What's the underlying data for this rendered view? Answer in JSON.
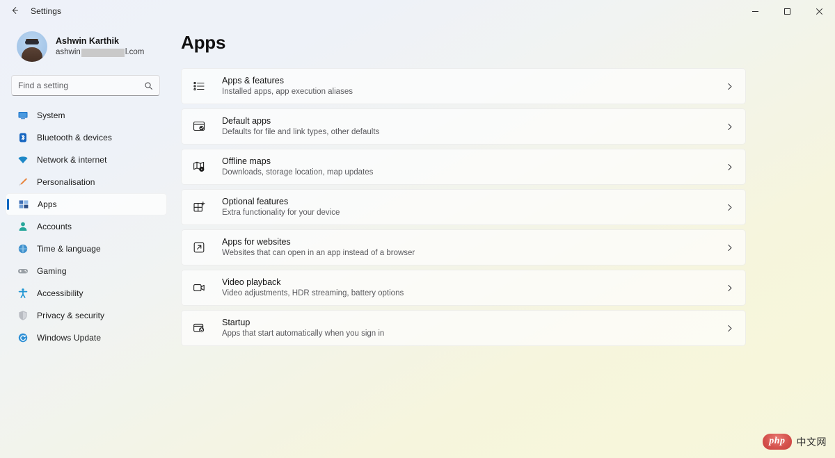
{
  "window": {
    "title": "Settings",
    "back_icon": "back-arrow-icon",
    "controls": {
      "minimize_label": "Minimize",
      "maximize_label": "Maximize",
      "close_label": "Close"
    }
  },
  "account": {
    "name": "Ashwin Karthik",
    "email_prefix": "ashwin",
    "email_suffix": "l.com",
    "avatar_label": "user-avatar"
  },
  "search": {
    "placeholder": "Find a setting",
    "value": "",
    "icon": "search-icon"
  },
  "sidebar": {
    "items": [
      {
        "label": "System",
        "icon": "monitor-icon",
        "selected": false
      },
      {
        "label": "Bluetooth & devices",
        "icon": "bluetooth-icon",
        "selected": false
      },
      {
        "label": "Network & internet",
        "icon": "wifi-icon",
        "selected": false
      },
      {
        "label": "Personalisation",
        "icon": "paintbrush-icon",
        "selected": false
      },
      {
        "label": "Apps",
        "icon": "apps-grid-icon",
        "selected": true
      },
      {
        "label": "Accounts",
        "icon": "person-icon",
        "selected": false
      },
      {
        "label": "Time & language",
        "icon": "clock-globe-icon",
        "selected": false
      },
      {
        "label": "Gaming",
        "icon": "gamepad-icon",
        "selected": false
      },
      {
        "label": "Accessibility",
        "icon": "accessibility-person-icon",
        "selected": false
      },
      {
        "label": "Privacy & security",
        "icon": "shield-icon",
        "selected": false
      },
      {
        "label": "Windows Update",
        "icon": "update-refresh-icon",
        "selected": false
      }
    ]
  },
  "main": {
    "title": "Apps",
    "cards": [
      {
        "title": "Apps & features",
        "subtitle": "Installed apps, app execution aliases",
        "icon": "list-bullets-icon",
        "chevron": "chevron-right-icon"
      },
      {
        "title": "Default apps",
        "subtitle": "Defaults for file and link types, other defaults",
        "icon": "window-check-icon",
        "chevron": "chevron-right-icon"
      },
      {
        "title": "Offline maps",
        "subtitle": "Downloads, storage location, map updates",
        "icon": "map-gear-icon",
        "chevron": "chevron-right-icon"
      },
      {
        "title": "Optional features",
        "subtitle": "Extra functionality for your device",
        "icon": "grid-plus-icon",
        "chevron": "chevron-right-icon"
      },
      {
        "title": "Apps for websites",
        "subtitle": "Websites that can open in an app instead of a browser",
        "icon": "external-link-box-icon",
        "chevron": "chevron-right-icon"
      },
      {
        "title": "Video playback",
        "subtitle": "Video adjustments, HDR streaming, battery options",
        "icon": "video-camera-icon",
        "chevron": "chevron-right-icon"
      },
      {
        "title": "Startup",
        "subtitle": "Apps that start automatically when you sign in",
        "icon": "window-power-icon",
        "chevron": "chevron-right-icon"
      }
    ]
  },
  "watermark": {
    "badge": "php",
    "text": "中文网"
  },
  "colors": {
    "accent": "#0067c0",
    "bg_top": "#eef1f9",
    "bg_bottom": "#f6f5dc",
    "card_bg": "#fdfdfd",
    "text_primary": "#141414",
    "text_secondary": "#5a5a5e"
  }
}
